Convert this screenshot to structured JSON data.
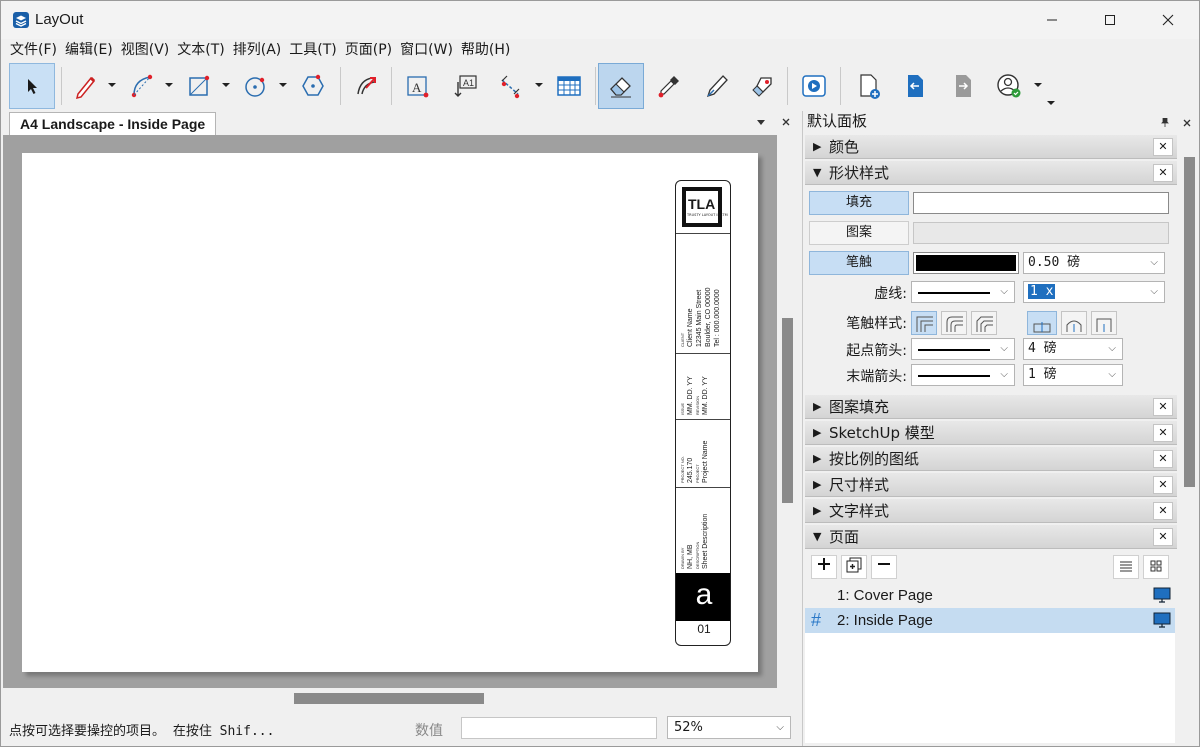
{
  "window": {
    "title": "LayOut",
    "minimize_icon": "minimize-icon",
    "maximize_icon": "maximize-icon",
    "close_icon": "close-icon"
  },
  "menu": [
    "文件(F)",
    "编辑(E)",
    "视图(V)",
    "文本(T)",
    "排列(A)",
    "工具(T)",
    "页面(P)",
    "窗口(W)",
    "帮助(H)"
  ],
  "toolbar": {
    "tools": [
      "select-tool",
      "line-tool",
      "arc-tool",
      "rectangle-tool",
      "circle-tool",
      "polygon-tool",
      "offset-tool",
      "text-tool",
      "label-tool",
      "dimension-tool",
      "table-tool",
      "eraser-tool",
      "style-tool",
      "split-tool",
      "join-tool",
      "presentation-tool",
      "add-page-tool",
      "previous-page-tool",
      "next-page-tool",
      "account-tool"
    ]
  },
  "document": {
    "tab_label": "A4 Landscape - Inside Page",
    "title_block": {
      "logo_text": "TLA",
      "logo_sub": "TRUSTY LAYOUT INCTM",
      "client_label": "CLIENT",
      "client_lines": [
        "Client Name",
        "12345 Main Street",
        "Boulder, CO 00000",
        "Tel : 000.000.0000"
      ],
      "issue_label": "ISSUE",
      "issue_value": "MM. DD. YY",
      "revision_label": "REVISION",
      "revision_value": "MM. DD. YY",
      "project_no_label": "PROJECT NO.",
      "project_no_value": "245.170",
      "project_label": "PROJECT",
      "project_value": "Project Name",
      "drawn_label": "DRAWN BY",
      "drawn_value": "NH, MB",
      "description_label": "DESCRIPTION",
      "description_value": "Sheet Description",
      "sheet_letter": "a",
      "sheet_number": "01"
    }
  },
  "status": {
    "hint": "点按可选择要操控的项目。 在按住 Shif...",
    "value_label": "数值",
    "value_input": "",
    "zoom": "52%"
  },
  "panel": {
    "title": "默认面板",
    "sections": {
      "colors": "颜色",
      "shape_style": "形状样式",
      "pattern_fill": "图案填充",
      "sketchup_model": "SketchUp 模型",
      "scaled_drawing": "按比例的图纸",
      "dimension_style": "尺寸样式",
      "text_style": "文字样式",
      "pages": "页面"
    },
    "shape_style": {
      "fill_label": "填充",
      "pattern_label": "图案",
      "stroke_label": "笔触",
      "stroke_color": "#000000",
      "stroke_width": "0.50 磅",
      "dash_label": "虚线:",
      "dash_scale": "1 x",
      "stroke_style_label": "笔触样式:",
      "start_arrow_label": "起点箭头:",
      "start_arrow_size": "4 磅",
      "end_arrow_label": "末端箭头:",
      "end_arrow_size": "1 磅"
    },
    "pages": [
      {
        "label": "1: Cover Page",
        "selected": false
      },
      {
        "label": "2: Inside Page",
        "selected": true
      }
    ]
  },
  "colors": {
    "accent": "#c7def4",
    "selected_row": "#c5dcf1",
    "red": "#e0202a",
    "blue_icon": "#1f6fbf"
  }
}
